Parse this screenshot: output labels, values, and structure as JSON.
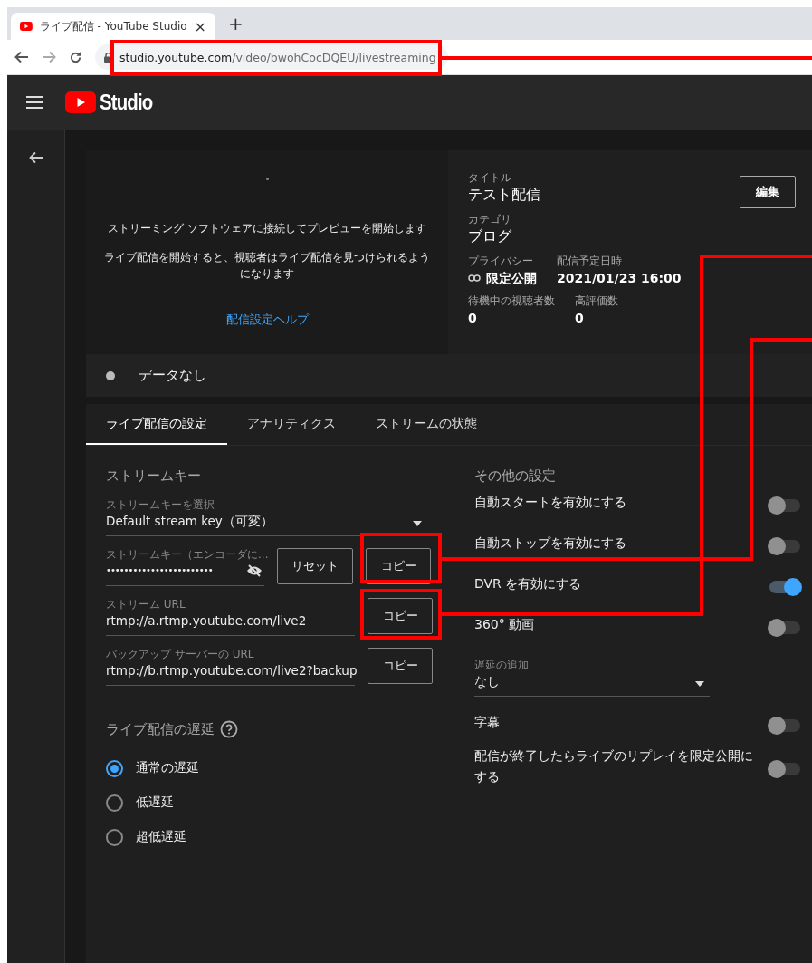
{
  "browser": {
    "tab": {
      "title": "ライブ配信 - YouTube Studio",
      "close": "×"
    },
    "new_tab": "+",
    "url": {
      "host": "studio.youtube.com",
      "path": "/video/bwohCocDQEU/livestreaming"
    }
  },
  "header": {
    "logo_text": "Studio"
  },
  "preview": {
    "message": "ストリーミング ソフトウェアに接続してプレビューを開始します",
    "note": "ライブ配信を開始すると、視聴者はライブ配信を見つけられるようになります",
    "help_link": "配信設定ヘルプ"
  },
  "details": {
    "edit_button": "編集",
    "title_label": "タイトル",
    "title": "テスト配信",
    "category_label": "カテゴリ",
    "category": "ブログ",
    "stats": [
      {
        "label": "プライバシー",
        "value": "限定公開",
        "kind": "privacy"
      },
      {
        "label": "配信予定日時",
        "value": "2021/01/23 16:00",
        "kind": "plain"
      }
    ],
    "counts": [
      {
        "label": "待機中の視聴者数",
        "value": "0"
      },
      {
        "label": "高評価数",
        "value": "0"
      }
    ]
  },
  "status": {
    "text": "データなし"
  },
  "tabs": [
    {
      "label": "ライブ配信の設定",
      "selected": true
    },
    {
      "label": "アナリティクス",
      "selected": false
    },
    {
      "label": "ストリームの状態",
      "selected": false
    }
  ],
  "stream_key": {
    "heading": "ストリームキー",
    "select_label": "ストリームキーを選択",
    "select_value": "Default stream key（可変）",
    "key_label": "ストリームキー（エンコーダに...",
    "key_value": "••••••••••••••••••••••••",
    "reset_button": "リセット",
    "copy_button": "コピー",
    "url_label": "ストリーム URL",
    "url_value": "rtmp://a.rtmp.youtube.com/live2",
    "url_copy": "コピー",
    "backup_label": "バックアップ サーバーの URL",
    "backup_value": "rtmp://b.rtmp.youtube.com/live2?backup",
    "backup_copy": "コピー"
  },
  "latency": {
    "heading": "ライブ配信の遅延",
    "options": [
      {
        "label": "通常の遅延",
        "selected": true
      },
      {
        "label": "低遅延",
        "selected": false
      },
      {
        "label": "超低遅延",
        "selected": false
      }
    ]
  },
  "other_settings": {
    "heading": "その他の設定",
    "items": [
      {
        "kind": "toggle",
        "label": "自動スタートを有効にする",
        "on": false
      },
      {
        "kind": "toggle",
        "label": "自動ストップを有効にする",
        "on": false
      },
      {
        "kind": "toggle",
        "label": "DVR を有効にする",
        "on": true
      },
      {
        "kind": "toggle",
        "label": "360° 動画",
        "on": false
      },
      {
        "kind": "select",
        "label": "遅延の追加",
        "value": "なし"
      },
      {
        "kind": "toggle",
        "label": "字幕",
        "on": false
      },
      {
        "kind": "toggle",
        "label": "配信が終了したらライブのリプレイを限定公開にする",
        "on": false
      }
    ]
  }
}
